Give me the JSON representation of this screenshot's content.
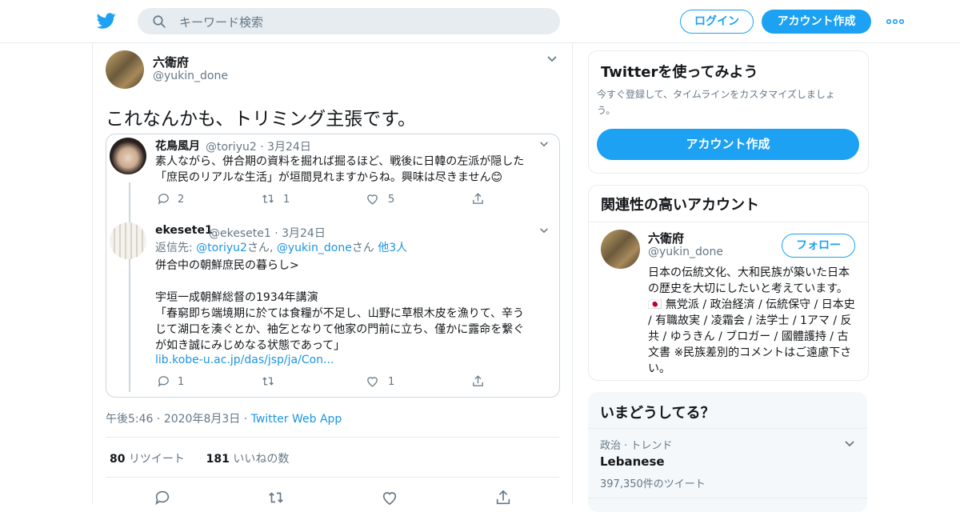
{
  "header": {
    "search_placeholder": "キーワード検索",
    "login_label": "ログイン",
    "signup_label": "アカウント作成"
  },
  "tweet": {
    "author_name": "六衛府",
    "author_handle": "@yukin_done",
    "text": "これなんかも、トリミング主張です。",
    "quote": {
      "first": {
        "name": "花鳥風月",
        "handle_date": "@toriyu2 · 3月24日",
        "lines": [
          "素人ながら、併合期の資料を掘れば掘るほど、戦後に日韓の左派が隠した",
          "「庶民のリアルな生活」が垣間見れますからね。興味は尽きません😊"
        ],
        "reply_count": "2",
        "retweet_count": "1",
        "like_count": "5"
      },
      "second": {
        "name": "ekesete1",
        "handle_date": "@ekesete1 · 3月24日",
        "reply_to_prefix": "返信先: ",
        "reply_to_mention1": "@toriyu2",
        "reply_to_mid": "さん, ",
        "reply_to_mention2": "@yukin_done",
        "reply_to_suffix": "さん ",
        "reply_to_others": "他3人",
        "lines": [
          "併合中の朝鮮庶民の暮らし>",
          "",
          "宇垣一成朝鮮総督の1934年講演",
          "「春窮即ち端境期に於ては食糧が不足し、山野に草根木皮を漁りて、辛う",
          "じて湖口を湊ぐとか、袖乞となりて他家の門前に立ち、僅かに露命を繋ぐ",
          "が如き誠にみじめなる状態であって」"
        ],
        "link": "lib.kobe-u.ac.jp/das/jsp/ja/Con...",
        "reply_count": "1",
        "like_count": "1"
      }
    },
    "time": "午後5:46",
    "date": "2020年8月3日",
    "source": "Twitter Web App",
    "retweets_num": "80",
    "retweets_label": "リツイート",
    "likes_num": "181",
    "likes_label": "いいねの数"
  },
  "sidebar": {
    "try_title": "Twitterを使ってみよう",
    "try_desc_1": "今すぐ登録して、タイムラインをカスタマイズしましょ",
    "try_desc_2": "う。",
    "try_button": "アカウント作成",
    "related_title": "関連性の高いアカウント",
    "related": {
      "name": "六衛府",
      "handle": "@yukin_done",
      "follow_label": "フォロー",
      "bio": "日本の伝統文化、大和民族が築いた日本の歴史を大切にしたいと考えています。🇯🇵 無党派 / 政治経済 / 伝統保守 / 日本史 / 有職故実 / 凌霜会 / 法学士 / 1アマ / 反共 / ゆうきん / ブロガー / 國體護持 / 古文書 ※民族差別的コメントはご遠慮下さい。"
    },
    "trends_title": "いまどうしてる？",
    "trend": {
      "category": "政治 · トレンド",
      "name": "Lebanese",
      "count": "397,350件のツイート"
    }
  },
  "colors": {
    "accent": "#1da1f2",
    "text": "#14171a",
    "secondary": "#657786",
    "border": "#e6ecf0"
  }
}
